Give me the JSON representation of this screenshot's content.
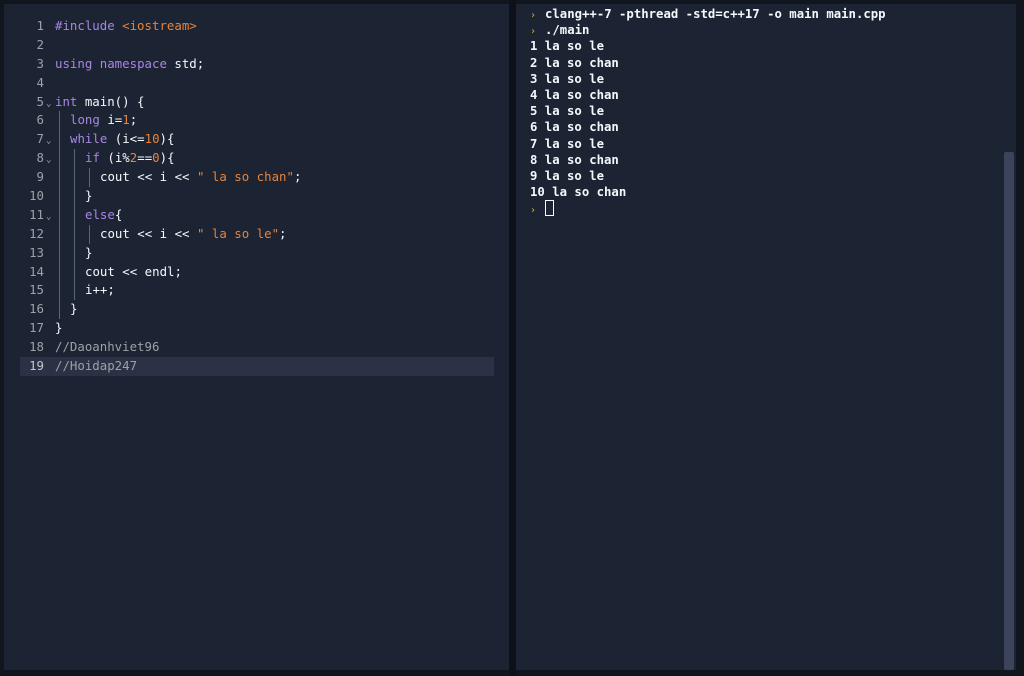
{
  "colors": {
    "background": "#11151d",
    "pane": "#1c2333",
    "text": "#f5f9fc",
    "keyword": "#a886e3",
    "string": "#e8833a",
    "number": "#e8833a",
    "comment": "#9da2a6",
    "prompt": "#d4a93a"
  },
  "editor": {
    "active_line": 19,
    "lines": [
      {
        "num": "1",
        "tokens": [
          {
            "t": "#include ",
            "c": "keyword"
          },
          {
            "t": "<iostream>",
            "c": "string"
          }
        ]
      },
      {
        "num": "2",
        "tokens": []
      },
      {
        "num": "3",
        "tokens": [
          {
            "t": "using ",
            "c": "keyword"
          },
          {
            "t": "namespace ",
            "c": "keyword"
          },
          {
            "t": "std;",
            "c": "text"
          }
        ]
      },
      {
        "num": "4",
        "tokens": []
      },
      {
        "num": "5",
        "fold": true,
        "tokens": [
          {
            "t": "int ",
            "c": "keyword"
          },
          {
            "t": "main() {",
            "c": "text"
          }
        ]
      },
      {
        "num": "6",
        "indent": 1,
        "tokens": [
          {
            "t": "long ",
            "c": "keyword"
          },
          {
            "t": "i=",
            "c": "text"
          },
          {
            "t": "1",
            "c": "number"
          },
          {
            "t": ";",
            "c": "text"
          }
        ]
      },
      {
        "num": "7",
        "indent": 1,
        "fold": true,
        "tokens": [
          {
            "t": "while ",
            "c": "keyword"
          },
          {
            "t": "(i<=",
            "c": "text"
          },
          {
            "t": "10",
            "c": "number"
          },
          {
            "t": "){",
            "c": "text"
          }
        ]
      },
      {
        "num": "8",
        "indent": 2,
        "fold": true,
        "tokens": [
          {
            "t": "if ",
            "c": "keyword"
          },
          {
            "t": "(i%",
            "c": "text"
          },
          {
            "t": "2",
            "c": "number"
          },
          {
            "t": "==",
            "c": "text"
          },
          {
            "t": "0",
            "c": "number"
          },
          {
            "t": "){",
            "c": "text"
          }
        ]
      },
      {
        "num": "9",
        "indent": 3,
        "tokens": [
          {
            "t": "cout << i << ",
            "c": "text"
          },
          {
            "t": "\" la so chan\"",
            "c": "string"
          },
          {
            "t": ";",
            "c": "text"
          }
        ]
      },
      {
        "num": "10",
        "indent": 2,
        "tokens": [
          {
            "t": "}",
            "c": "text"
          }
        ]
      },
      {
        "num": "11",
        "indent": 2,
        "fold": true,
        "tokens": [
          {
            "t": "else",
            "c": "keyword"
          },
          {
            "t": "{",
            "c": "text"
          }
        ]
      },
      {
        "num": "12",
        "indent": 3,
        "tokens": [
          {
            "t": "cout << i << ",
            "c": "text"
          },
          {
            "t": "\" la so le\"",
            "c": "string"
          },
          {
            "t": ";",
            "c": "text"
          }
        ]
      },
      {
        "num": "13",
        "indent": 2,
        "tokens": [
          {
            "t": "}",
            "c": "text"
          }
        ]
      },
      {
        "num": "14",
        "indent": 2,
        "tokens": [
          {
            "t": "cout << endl;",
            "c": "text"
          }
        ]
      },
      {
        "num": "15",
        "indent": 2,
        "tokens": [
          {
            "t": "i++;",
            "c": "text"
          }
        ]
      },
      {
        "num": "16",
        "indent": 1,
        "tokens": [
          {
            "t": "}",
            "c": "text"
          }
        ]
      },
      {
        "num": "17",
        "tokens": [
          {
            "t": "}",
            "c": "text"
          }
        ]
      },
      {
        "num": "18",
        "tokens": [
          {
            "t": "//Daoanhviet96",
            "c": "comment"
          }
        ]
      },
      {
        "num": "19",
        "tokens": [
          {
            "t": "//Hoidap247",
            "c": "comment"
          }
        ]
      }
    ]
  },
  "console": {
    "prompt_icon": "prompt-chevron-icon",
    "lines": [
      {
        "prompt": true,
        "text": "clang++-7 -pthread -std=c++17 -o main main.cpp"
      },
      {
        "prompt": true,
        "text": "./main"
      },
      {
        "text": "1 la so le"
      },
      {
        "text": "2 la so chan"
      },
      {
        "text": "3 la so le"
      },
      {
        "text": "4 la so chan"
      },
      {
        "text": "5 la so le"
      },
      {
        "text": "6 la so chan"
      },
      {
        "text": "7 la so le"
      },
      {
        "text": "8 la so chan"
      },
      {
        "text": "9 la so le"
      },
      {
        "text": "10 la so chan"
      },
      {
        "prompt": true,
        "text": "",
        "cursor": true
      }
    ]
  }
}
